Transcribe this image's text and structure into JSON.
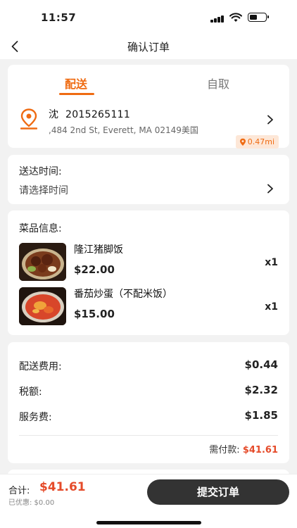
{
  "status_bar": {
    "time": "11:57"
  },
  "nav": {
    "title": "确认订单"
  },
  "delivery_tabs": [
    {
      "label": "配送",
      "active": true
    },
    {
      "label": "自取",
      "active": false
    }
  ],
  "address": {
    "name": "沈",
    "phone": "2015265111",
    "line": ",484 2nd St, Everett, MA 02149美国",
    "distance": "0.47mi"
  },
  "delivery_time": {
    "label": "送达时间:",
    "placeholder": "请选择时间"
  },
  "dishes": {
    "label": "菜品信息:",
    "items": [
      {
        "name": "隆江猪脚饭",
        "price": "$22.00",
        "qty": "x1"
      },
      {
        "name": "番茄炒蛋（不配米饭）",
        "price": "$15.00",
        "qty": "x1"
      }
    ]
  },
  "fees": {
    "items": [
      {
        "label": "配送费用:",
        "value": "$0.44"
      },
      {
        "label": "税额:",
        "value": "$2.32"
      },
      {
        "label": "服务费:",
        "value": "$1.85"
      }
    ],
    "need_label": "需付款:",
    "need_value": "$41.61"
  },
  "footer": {
    "total_label": "合计:",
    "total_value": "$41.61",
    "discount_text": "已优惠: $0.00",
    "submit_label": "提交订单"
  },
  "colors": {
    "accent": "#ef6b12",
    "price_red": "#e54b2a",
    "button_dark": "#333333"
  }
}
